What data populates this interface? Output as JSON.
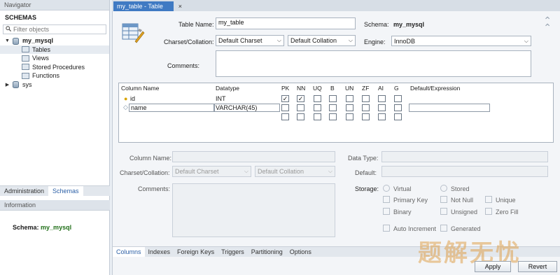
{
  "navigator": {
    "title": "Navigator",
    "schemas_header": "SCHEMAS",
    "filter_placeholder": "Filter objects",
    "tree": [
      {
        "label": "my_mysql",
        "bold": true
      },
      {
        "label": "Tables"
      },
      {
        "label": "Views"
      },
      {
        "label": "Stored Procedures"
      },
      {
        "label": "Functions"
      },
      {
        "label": "sys"
      }
    ],
    "tabs": [
      "Administration",
      "Schemas"
    ],
    "info_title": "Information",
    "info_schema_label": "Schema:",
    "info_schema_value": "my_mysql"
  },
  "editor_tab": {
    "label": "my_table - Table",
    "close": "×"
  },
  "form": {
    "table_name_label": "Table Name:",
    "table_name_value": "my_table",
    "schema_label": "Schema:",
    "schema_value": "my_mysql",
    "charset_label": "Charset/Collation:",
    "charset_value": "Default Charset",
    "collation_value": "Default Collation",
    "engine_label": "Engine:",
    "engine_value": "InnoDB",
    "comments_label": "Comments:"
  },
  "grid": {
    "headers": [
      "Column Name",
      "Datatype",
      "PK",
      "NN",
      "UQ",
      "B",
      "UN",
      "ZF",
      "AI",
      "G",
      "Default/Expression"
    ],
    "rows": [
      {
        "name": "id",
        "datatype": "INT",
        "pk": true,
        "nn": true
      },
      {
        "name": "name",
        "datatype": "VARCHAR(45)",
        "pk": false,
        "nn": false
      }
    ]
  },
  "details": {
    "column_name_label": "Column Name:",
    "data_type_label": "Data Type:",
    "charset_label": "Charset/Collation:",
    "charset_value": "Default Charset",
    "collation_value": "Default Collation",
    "default_label": "Default:",
    "comments_label": "Comments:",
    "storage_label": "Storage:",
    "virtual": "Virtual",
    "stored": "Stored",
    "primary_key": "Primary Key",
    "not_null": "Not Null",
    "unique": "Unique",
    "binary": "Binary",
    "unsigned": "Unsigned",
    "zero_fill": "Zero Fill",
    "auto_increment": "Auto Increment",
    "generated": "Generated"
  },
  "bottom_tabs": [
    "Columns",
    "Indexes",
    "Foreign Keys",
    "Triggers",
    "Partitioning",
    "Options"
  ],
  "buttons": {
    "apply": "Apply",
    "revert": "Revert"
  },
  "watermark": "题解无忧",
  "colors": {
    "accent": "#3f7ac3",
    "schema_green": "#1f6e17"
  }
}
